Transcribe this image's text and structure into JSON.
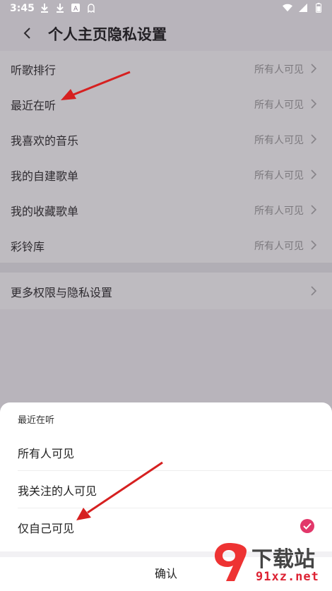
{
  "status_bar": {
    "time": "3:45",
    "left_icons": [
      "download-icon",
      "download-icon",
      "font-app-icon",
      "ghost-app-icon"
    ],
    "right_icons": [
      "wifi-icon",
      "signal-icon",
      "battery-icon"
    ]
  },
  "header": {
    "title": "个人主页隐私设置"
  },
  "privacy_items": [
    {
      "label": "听歌排行",
      "value": "所有人可见"
    },
    {
      "label": "最近在听",
      "value": "所有人可见"
    },
    {
      "label": "我喜欢的音乐",
      "value": "所有人可见"
    },
    {
      "label": "我的自建歌单",
      "value": "所有人可见"
    },
    {
      "label": "我的收藏歌单",
      "value": "所有人可见"
    },
    {
      "label": "彩铃库",
      "value": "所有人可见"
    }
  ],
  "more_settings": {
    "label": "更多权限与隐私设置"
  },
  "sheet": {
    "title": "最近在听",
    "options": [
      {
        "label": "所有人可见",
        "selected": false
      },
      {
        "label": "我关注的人可见",
        "selected": false
      },
      {
        "label": "仅自己可见",
        "selected": true
      }
    ],
    "confirm_label": "确认"
  },
  "watermark": {
    "text": "下载站",
    "domain": "91xz.net"
  },
  "colors": {
    "accent": "#e2376a",
    "annotation_arrow": "#d62020"
  }
}
